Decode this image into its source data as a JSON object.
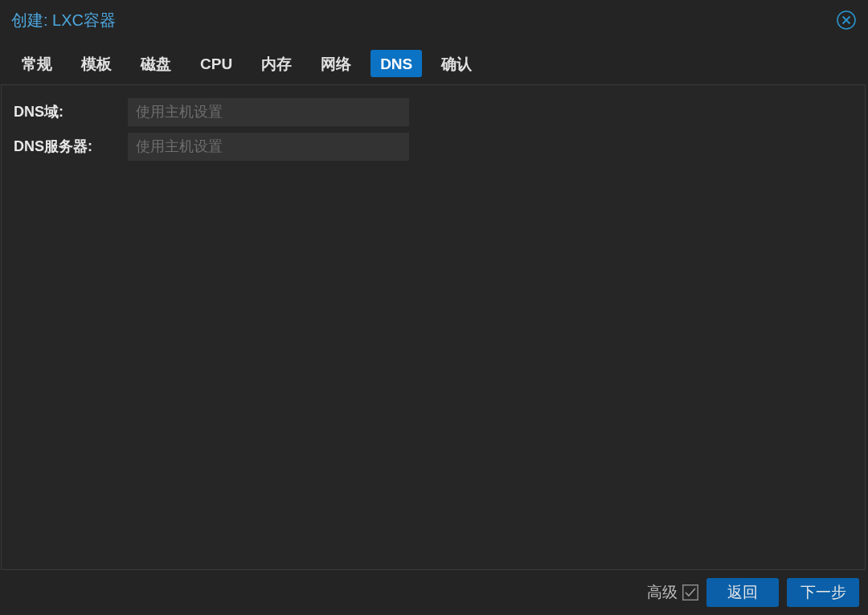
{
  "window": {
    "title": "创建: LXC容器"
  },
  "tabs": [
    {
      "label": "常规",
      "selected": false
    },
    {
      "label": "模板",
      "selected": false
    },
    {
      "label": "磁盘",
      "selected": false
    },
    {
      "label": "CPU",
      "selected": false
    },
    {
      "label": "内存",
      "selected": false
    },
    {
      "label": "网络",
      "selected": false
    },
    {
      "label": "DNS",
      "selected": true
    },
    {
      "label": "确认",
      "selected": false
    }
  ],
  "form": {
    "fields": [
      {
        "label": "DNS域:",
        "placeholder": "使用主机设置"
      },
      {
        "label": "DNS服务器:",
        "placeholder": "使用主机设置"
      }
    ]
  },
  "footer": {
    "advanced": {
      "label": "高级",
      "checked": true
    },
    "buttons": [
      "返回",
      "下一步"
    ]
  }
}
